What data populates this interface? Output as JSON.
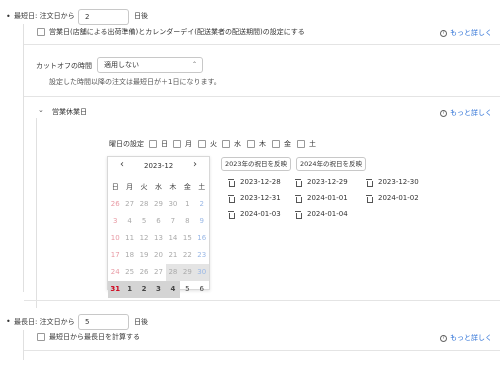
{
  "shortest": {
    "label": "最短日: 注文日から",
    "value": "2",
    "suffix": "日後",
    "checkbox_label": "営業日(店舗による出荷準備)とカレンダーデイ(配送業者の配送期間)の設定にする",
    "help": "もっと詳しく"
  },
  "cutoff": {
    "label": "カットオフの時間",
    "select_value": "適用しない",
    "note": "設定した時間以降の注文は最短日が＋1日になります。"
  },
  "holidays": {
    "section_label": "営業休業日",
    "help": "もっと詳しく",
    "weekday_label": "曜日の設定",
    "weekdays": [
      "日",
      "月",
      "火",
      "水",
      "木",
      "金",
      "土"
    ],
    "btn_2023": "2023年の祝日を反映",
    "btn_2024": "2024年の祝日を反映",
    "dates": [
      "2023-12-28",
      "2023-12-29",
      "2023-12-30",
      "2023-12-31",
      "2024-01-01",
      "2024-01-02",
      "2024-01-03",
      "2024-01-04"
    ]
  },
  "calendar": {
    "month": "2023-12",
    "prev": "‹",
    "next": "›",
    "dow": [
      "日",
      "月",
      "火",
      "水",
      "木",
      "金",
      "土"
    ],
    "weeks": [
      [
        "26",
        "27",
        "28",
        "29",
        "30",
        "1",
        "2"
      ],
      [
        "3",
        "4",
        "5",
        "6",
        "7",
        "8",
        "9"
      ],
      [
        "10",
        "11",
        "12",
        "13",
        "14",
        "15",
        "16"
      ],
      [
        "17",
        "18",
        "19",
        "20",
        "21",
        "22",
        "23"
      ],
      [
        "24",
        "25",
        "26",
        "27",
        "28",
        "29",
        "30"
      ],
      [
        "31",
        "1",
        "2",
        "3",
        "4",
        "5",
        "6"
      ]
    ]
  },
  "longest": {
    "label": "最長日: 注文日から",
    "value": "5",
    "suffix": "日後",
    "checkbox_label": "最短日から最長日を計算する",
    "help": "もっと詳しく"
  },
  "colors": {
    "link": "#2a6fd6",
    "sunday": "#d0021b",
    "saturday": "#2a6fd6"
  }
}
